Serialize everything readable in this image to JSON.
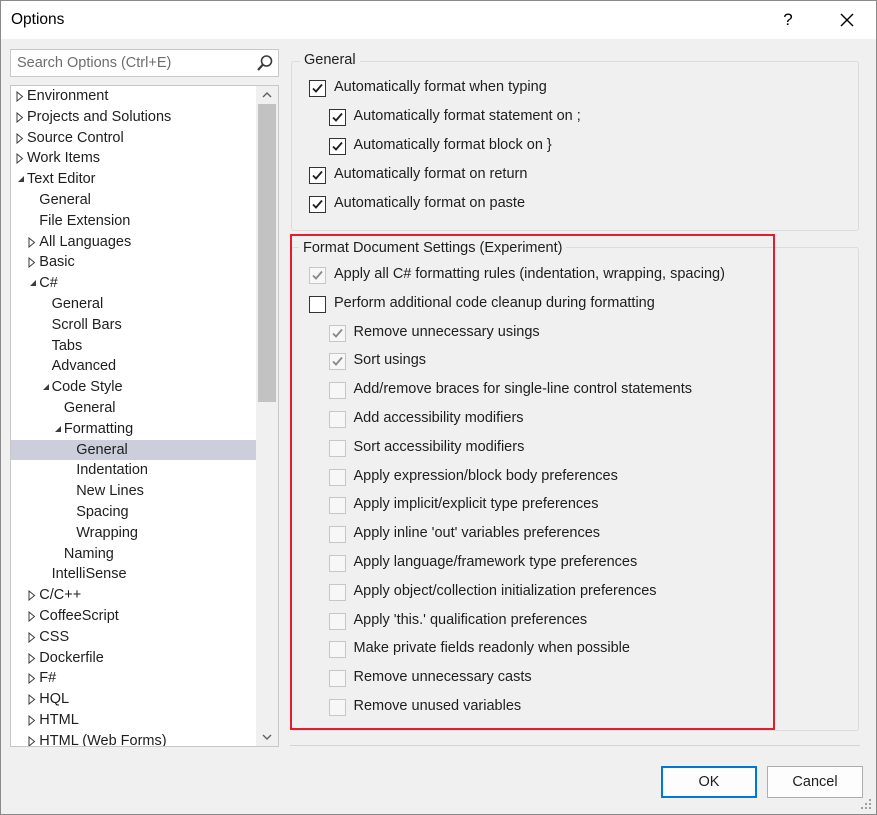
{
  "window": {
    "title": "Options",
    "help_label": "?"
  },
  "search": {
    "placeholder": "Search Options (Ctrl+E)"
  },
  "tree": {
    "items": [
      {
        "label": "Environment",
        "indent": 0,
        "arrow": "collapsed"
      },
      {
        "label": "Projects and Solutions",
        "indent": 0,
        "arrow": "collapsed"
      },
      {
        "label": "Source Control",
        "indent": 0,
        "arrow": "collapsed"
      },
      {
        "label": "Work Items",
        "indent": 0,
        "arrow": "collapsed"
      },
      {
        "label": "Text Editor",
        "indent": 0,
        "arrow": "expanded"
      },
      {
        "label": "General",
        "indent": 1,
        "arrow": "none"
      },
      {
        "label": "File Extension",
        "indent": 1,
        "arrow": "none"
      },
      {
        "label": "All Languages",
        "indent": 1,
        "arrow": "collapsed"
      },
      {
        "label": "Basic",
        "indent": 1,
        "arrow": "collapsed"
      },
      {
        "label": "C#",
        "indent": 1,
        "arrow": "expanded"
      },
      {
        "label": "General",
        "indent": 2,
        "arrow": "none"
      },
      {
        "label": "Scroll Bars",
        "indent": 2,
        "arrow": "none"
      },
      {
        "label": "Tabs",
        "indent": 2,
        "arrow": "none"
      },
      {
        "label": "Advanced",
        "indent": 2,
        "arrow": "none"
      },
      {
        "label": "Code Style",
        "indent": 2,
        "arrow": "expanded"
      },
      {
        "label": "General",
        "indent": 3,
        "arrow": "none"
      },
      {
        "label": "Formatting",
        "indent": 3,
        "arrow": "expanded"
      },
      {
        "label": "General",
        "indent": 4,
        "arrow": "none",
        "selected": true
      },
      {
        "label": "Indentation",
        "indent": 4,
        "arrow": "none"
      },
      {
        "label": "New Lines",
        "indent": 4,
        "arrow": "none"
      },
      {
        "label": "Spacing",
        "indent": 4,
        "arrow": "none"
      },
      {
        "label": "Wrapping",
        "indent": 4,
        "arrow": "none"
      },
      {
        "label": "Naming",
        "indent": 3,
        "arrow": "none"
      },
      {
        "label": "IntelliSense",
        "indent": 2,
        "arrow": "none"
      },
      {
        "label": "C/C++",
        "indent": 1,
        "arrow": "collapsed"
      },
      {
        "label": "CoffeeScript",
        "indent": 1,
        "arrow": "collapsed"
      },
      {
        "label": "CSS",
        "indent": 1,
        "arrow": "collapsed"
      },
      {
        "label": "Dockerfile",
        "indent": 1,
        "arrow": "collapsed"
      },
      {
        "label": "F#",
        "indent": 1,
        "arrow": "collapsed"
      },
      {
        "label": "HQL",
        "indent": 1,
        "arrow": "collapsed"
      },
      {
        "label": "HTML",
        "indent": 1,
        "arrow": "collapsed"
      },
      {
        "label": "HTML (Web Forms)",
        "indent": 1,
        "arrow": "collapsed"
      }
    ]
  },
  "general_group": {
    "label": "General",
    "options": [
      {
        "label": "Automatically format when typing",
        "checked": true,
        "enabled": true,
        "level": 0
      },
      {
        "label": "Automatically format statement on ;",
        "checked": true,
        "enabled": true,
        "level": 1
      },
      {
        "label": "Automatically format block on }",
        "checked": true,
        "enabled": true,
        "level": 1
      },
      {
        "label": "Automatically format on return",
        "checked": true,
        "enabled": true,
        "level": 0
      },
      {
        "label": "Automatically format on paste",
        "checked": true,
        "enabled": true,
        "level": 0
      }
    ]
  },
  "format_group": {
    "label": "Format Document Settings (Experiment)",
    "options": [
      {
        "label": "Apply all C# formatting rules (indentation, wrapping, spacing)",
        "checked": true,
        "enabled": false,
        "level": 0
      },
      {
        "label": "Perform additional code cleanup during formatting",
        "checked": false,
        "enabled": true,
        "level": 0
      },
      {
        "label": "Remove unnecessary usings",
        "checked": true,
        "enabled": false,
        "level": 1
      },
      {
        "label": "Sort usings",
        "checked": true,
        "enabled": false,
        "level": 1
      },
      {
        "label": "Add/remove braces for single-line control statements",
        "checked": false,
        "enabled": false,
        "level": 1
      },
      {
        "label": "Add accessibility modifiers",
        "checked": false,
        "enabled": false,
        "level": 1
      },
      {
        "label": "Sort accessibility modifiers",
        "checked": false,
        "enabled": false,
        "level": 1
      },
      {
        "label": "Apply expression/block body preferences",
        "checked": false,
        "enabled": false,
        "level": 1
      },
      {
        "label": "Apply implicit/explicit type preferences",
        "checked": false,
        "enabled": false,
        "level": 1
      },
      {
        "label": "Apply inline 'out' variables preferences",
        "checked": false,
        "enabled": false,
        "level": 1
      },
      {
        "label": "Apply language/framework type preferences",
        "checked": false,
        "enabled": false,
        "level": 1
      },
      {
        "label": "Apply object/collection initialization preferences",
        "checked": false,
        "enabled": false,
        "level": 1
      },
      {
        "label": "Apply 'this.' qualification preferences",
        "checked": false,
        "enabled": false,
        "level": 1
      },
      {
        "label": "Make private fields readonly when possible",
        "checked": false,
        "enabled": false,
        "level": 1
      },
      {
        "label": "Remove unnecessary casts",
        "checked": false,
        "enabled": false,
        "level": 1
      },
      {
        "label": "Remove unused variables",
        "checked": false,
        "enabled": false,
        "level": 1
      }
    ]
  },
  "footer": {
    "ok_label": "OK",
    "cancel_label": "Cancel"
  },
  "colors": {
    "highlight": "#e31d2b",
    "selection": "#cccedb",
    "accent": "#0078d7"
  },
  "icons": {
    "search": "search-icon",
    "close": "close-icon",
    "resize": "resize-grip-icon"
  }
}
